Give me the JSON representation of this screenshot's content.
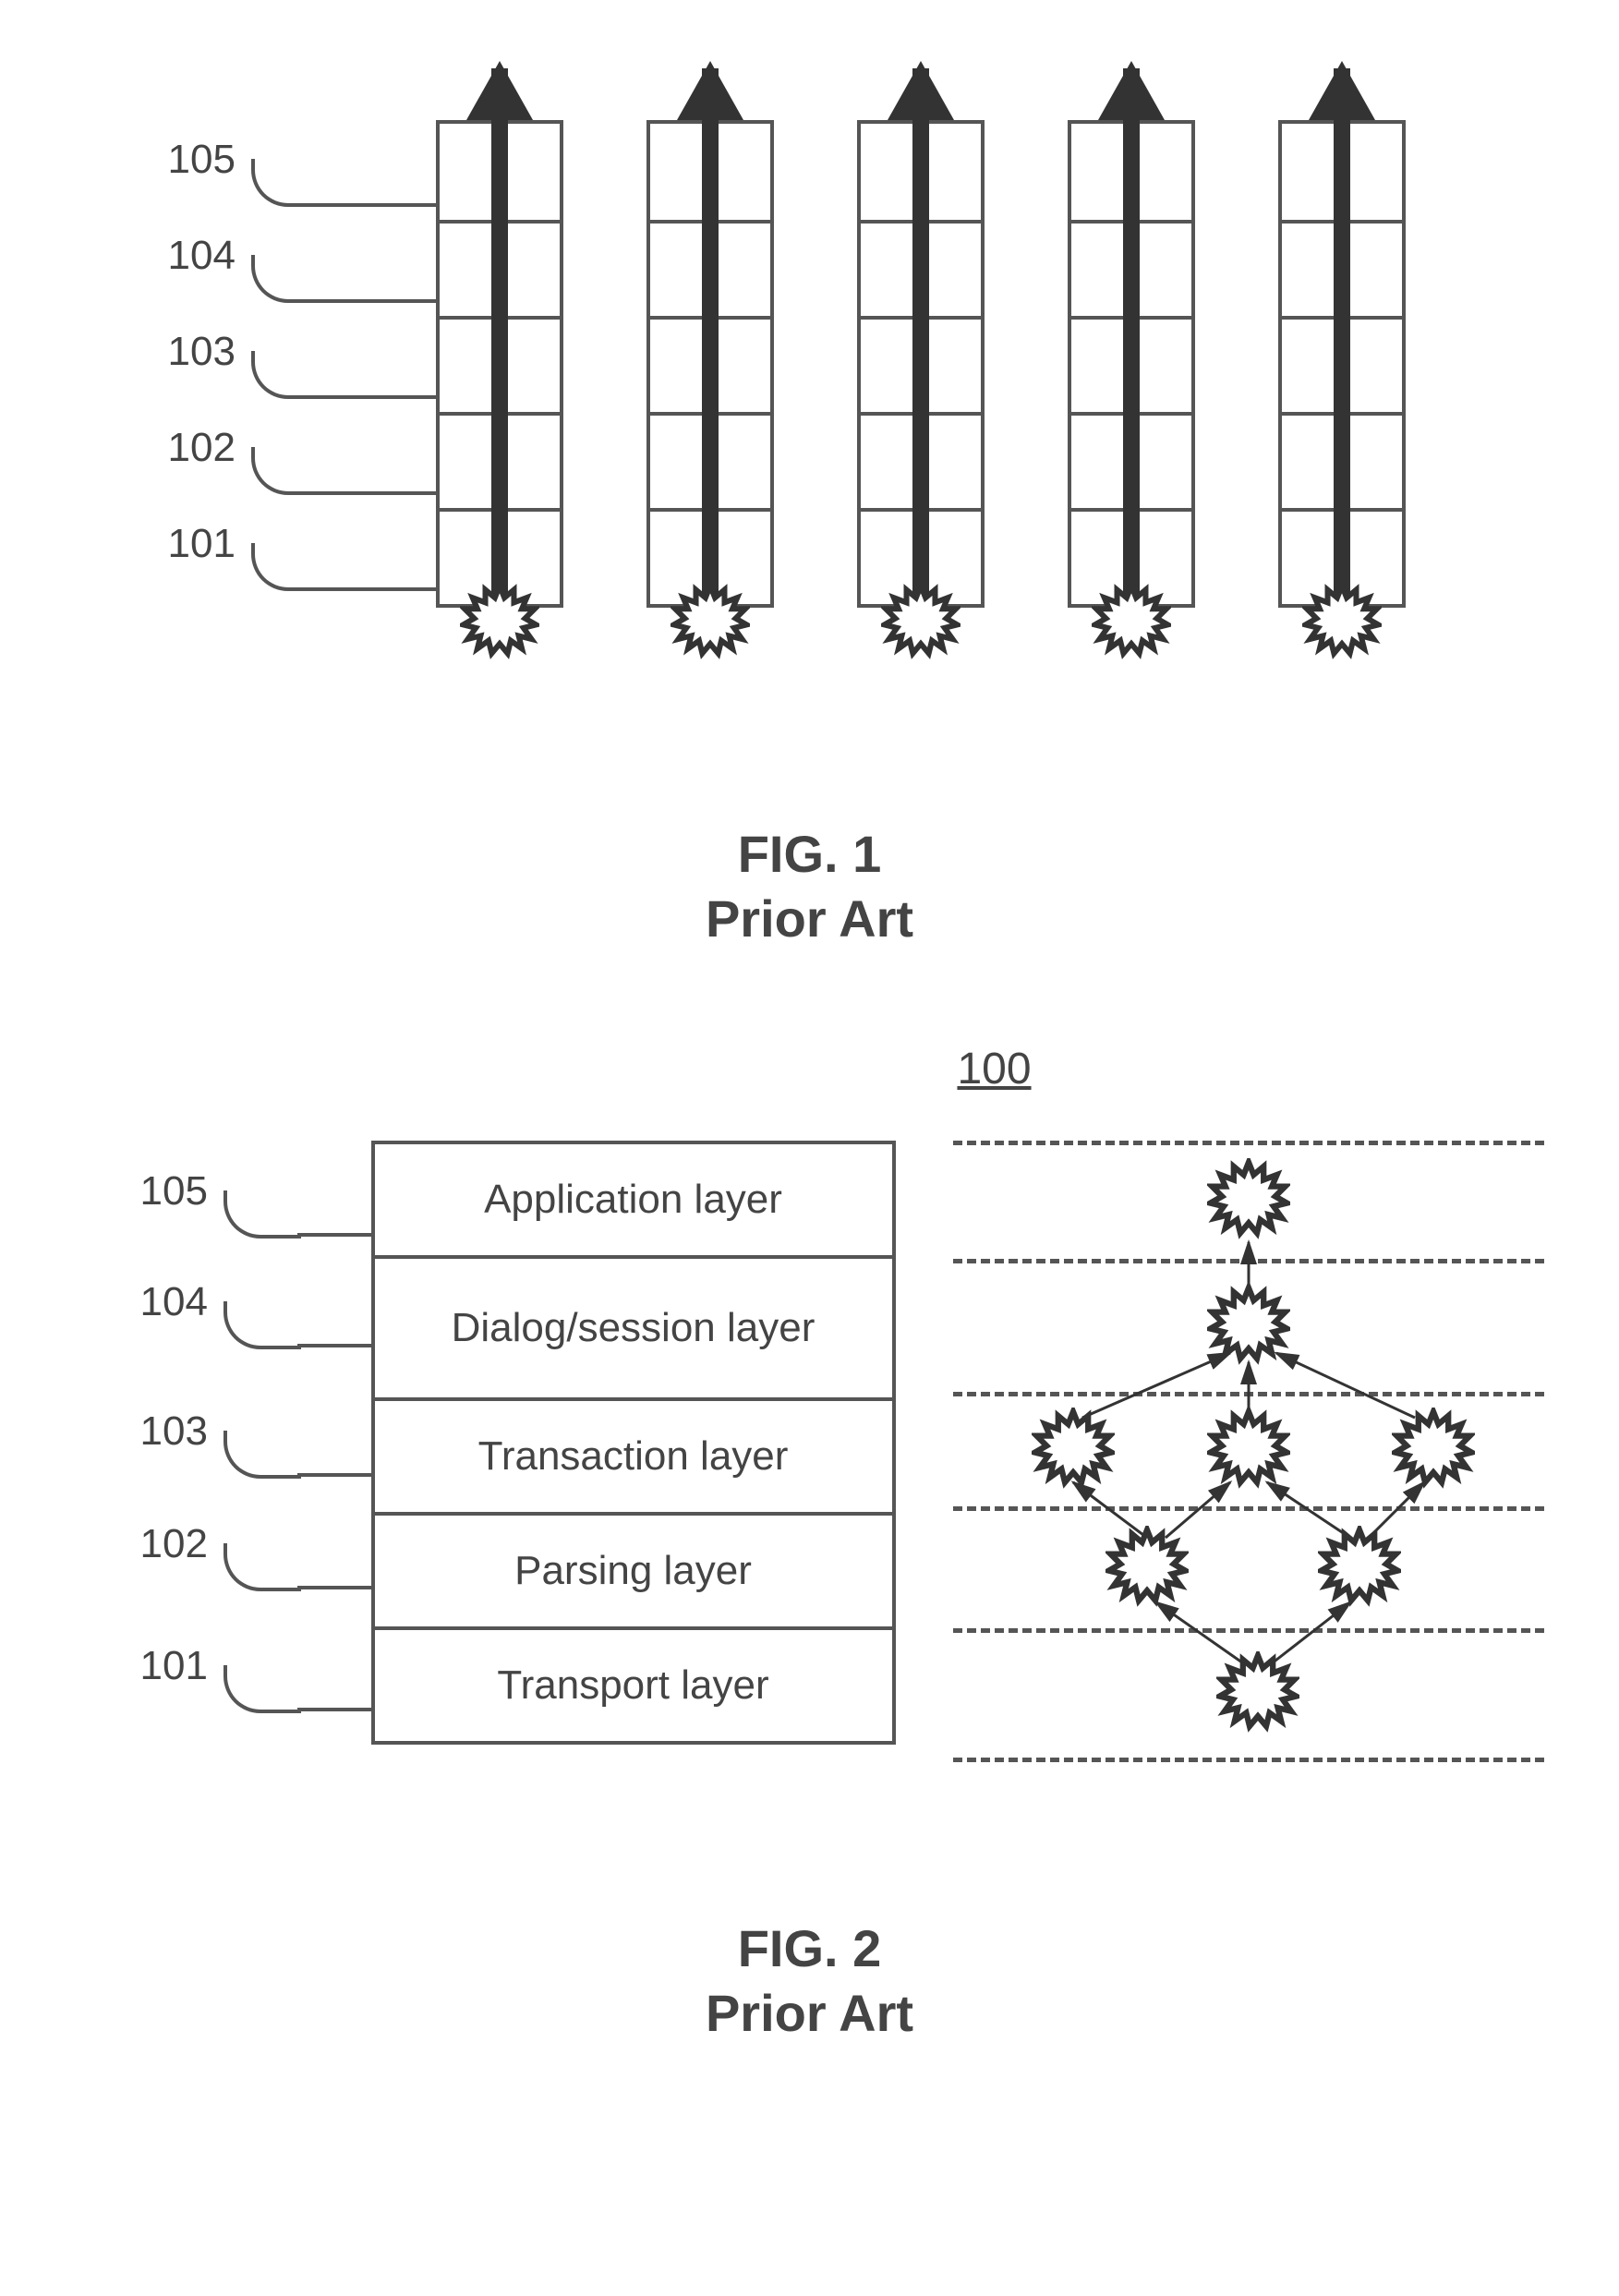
{
  "fig1": {
    "labels": [
      "105",
      "104",
      "103",
      "102",
      "101"
    ],
    "caption_line1": "FIG. 1",
    "caption_line2": "Prior Art"
  },
  "fig2": {
    "ref_number": "100",
    "labels": [
      "105",
      "104",
      "103",
      "102",
      "101"
    ],
    "rows": [
      "Application layer",
      "Dialog/session layer",
      "Transaction layer",
      "Parsing layer",
      "Transport layer"
    ],
    "caption_line1": "FIG. 2",
    "caption_line2": "Prior Art"
  }
}
